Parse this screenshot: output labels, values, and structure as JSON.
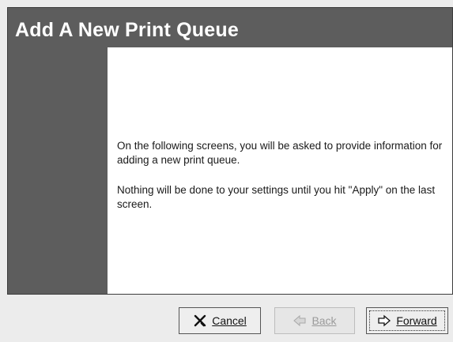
{
  "window": {
    "title": "Add A New Print Queue"
  },
  "content": {
    "paragraph_1": "On the following screens, you will be asked to provide information for adding a new print queue.",
    "paragraph_2": "Nothing will be done to your settings until you hit \"Apply\" on the last screen."
  },
  "buttons": {
    "cancel": {
      "label": "Cancel",
      "icon": "cancel-icon",
      "enabled": true
    },
    "back": {
      "label": "Back",
      "icon": "left-arrow-icon",
      "enabled": false
    },
    "forward": {
      "label": "Forward",
      "icon": "right-arrow-icon",
      "enabled": true,
      "focused": true
    }
  },
  "colors": {
    "header_bg": "#5d5d5d",
    "content_bg": "#ffffff",
    "window_bg": "#ececec"
  }
}
